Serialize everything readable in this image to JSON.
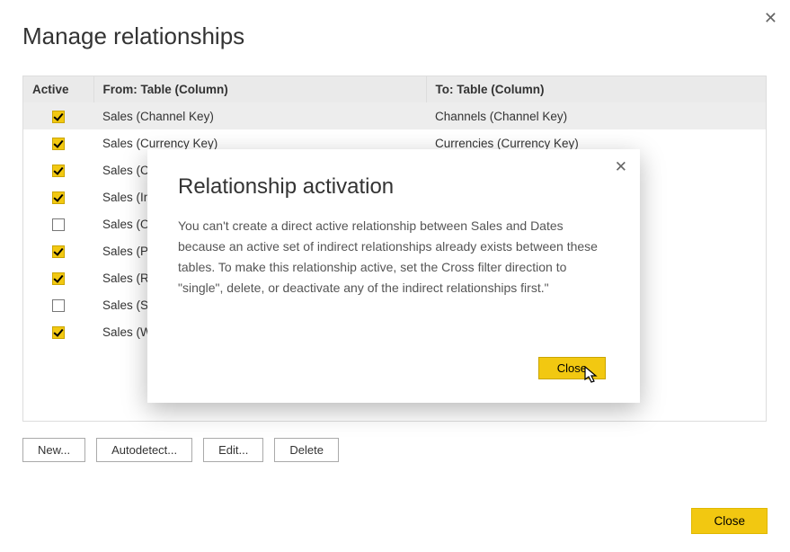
{
  "page_title": "Manage relationships",
  "columns": {
    "active": "Active",
    "from": "From: Table (Column)",
    "to": "To: Table (Column)"
  },
  "rows": [
    {
      "active": true,
      "from": "Sales (Channel Key)",
      "to": "Channels (Channel Key)",
      "selected": true
    },
    {
      "active": true,
      "from": "Sales (Currency Key)",
      "to": "Currencies (Currency Key)",
      "selected": false
    },
    {
      "active": true,
      "from": "Sales (Cu",
      "to": "",
      "selected": false
    },
    {
      "active": true,
      "from": "Sales (In",
      "to": "",
      "selected": false
    },
    {
      "active": false,
      "from": "Sales (Or",
      "to": "",
      "selected": false
    },
    {
      "active": true,
      "from": "Sales (Pr",
      "to": "",
      "selected": false
    },
    {
      "active": true,
      "from": "Sales (Re",
      "to": "",
      "selected": false
    },
    {
      "active": false,
      "from": "Sales (Sh",
      "to": "",
      "selected": false
    },
    {
      "active": true,
      "from": "Sales (W",
      "to": "",
      "selected": false
    }
  ],
  "buttons": {
    "new": "New...",
    "autodetect": "Autodetect...",
    "edit": "Edit...",
    "delete": "Delete",
    "close": "Close"
  },
  "modal": {
    "title": "Relationship activation",
    "body": "You can't create a direct active relationship between Sales and Dates because an active set of indirect relationships already exists between these tables. To make this relationship active, set the Cross filter direction to \"single\", delete, or deactivate any of the indirect relationships first.\"",
    "close_label": "Close"
  }
}
